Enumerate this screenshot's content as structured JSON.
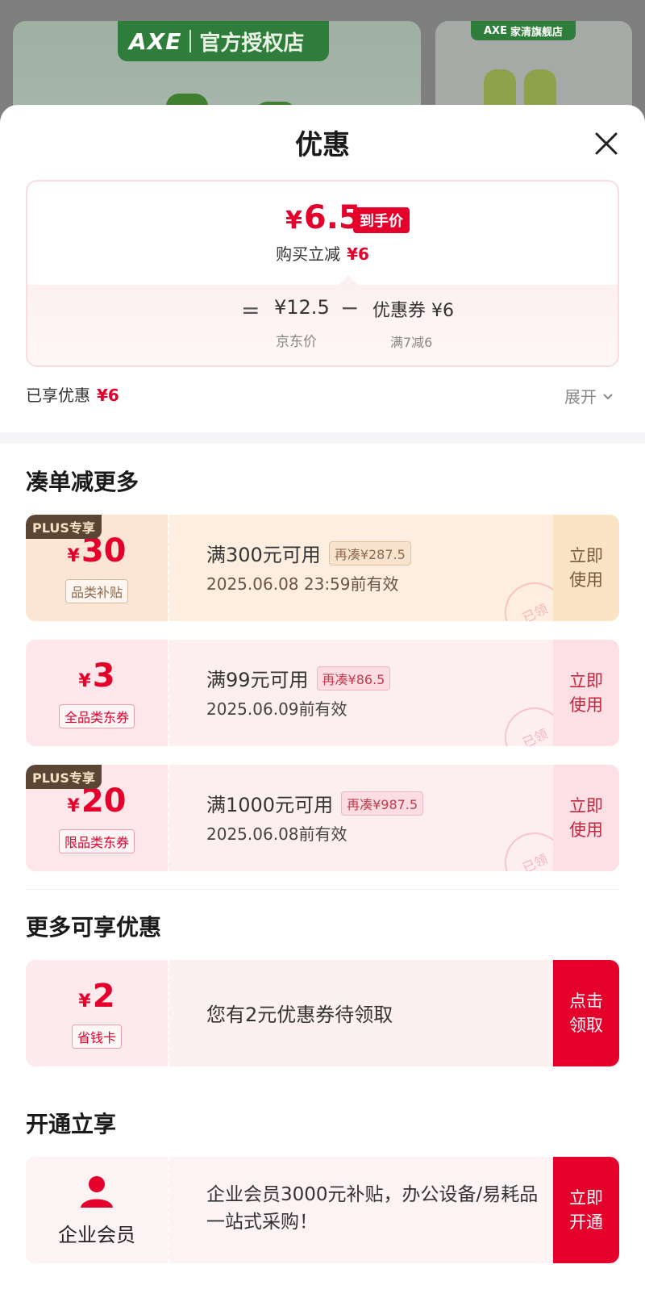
{
  "background": {
    "left_badge_logo": "AXE",
    "left_badge_text": "官方授权店",
    "right_badge_logo": "AXE",
    "right_badge_text": "家清旗舰店"
  },
  "sheet": {
    "title": "优惠"
  },
  "price_card": {
    "final_yen": "¥",
    "final_price": "6.5",
    "final_tag": "到手价",
    "reduce_label": "购买立减",
    "reduce_value": "¥6",
    "equals": "=",
    "jd_price": "¥12.5",
    "jd_label": "京东价",
    "minus": "−",
    "coupon_price": "优惠券 ¥6",
    "coupon_label": "满7减6"
  },
  "summary": {
    "enjoyed_label": "已享优惠",
    "enjoyed_value": "¥6",
    "expand_label": "展开"
  },
  "section_more_orders": {
    "title": "凑单减更多",
    "coupons": [
      {
        "plus_tag": "PLUS专享",
        "yen": "¥",
        "amount": "30",
        "tag": "品类补贴",
        "condition": "满300元可用",
        "more_tag": "再凑¥287.5",
        "expire": "2025.06.08 23:59前有效",
        "action": "立即使用",
        "stamp": "已领"
      },
      {
        "plus_tag": "",
        "yen": "¥",
        "amount": "3",
        "tag": "全品类东券",
        "condition": "满99元可用",
        "more_tag": "再凑¥86.5",
        "expire": "2025.06.09前有效",
        "action": "立即使用",
        "stamp": "已领"
      },
      {
        "plus_tag": "PLUS专享",
        "yen": "¥",
        "amount": "20",
        "tag": "限品类东券",
        "condition": "满1000元可用",
        "more_tag": "再凑¥987.5",
        "expire": "2025.06.08前有效",
        "action": "立即使用",
        "stamp": "已领"
      }
    ]
  },
  "section_more_offers": {
    "title": "更多可享优惠",
    "card": {
      "yen": "¥",
      "amount": "2",
      "tag": "省钱卡",
      "text": "您有2元优惠券待领取",
      "action": "点击领取"
    }
  },
  "section_open": {
    "title": "开通立享",
    "card": {
      "label": "企业会员",
      "text": "企业会员3000元补贴，办公设备/易耗品一站式采购！",
      "action": "立即开通"
    }
  },
  "colors": {
    "accent_red": "#e4002b",
    "plus_brown": "#5b4534",
    "coupon_peach": "#fdeee0",
    "coupon_pink": "#fdeef0"
  }
}
